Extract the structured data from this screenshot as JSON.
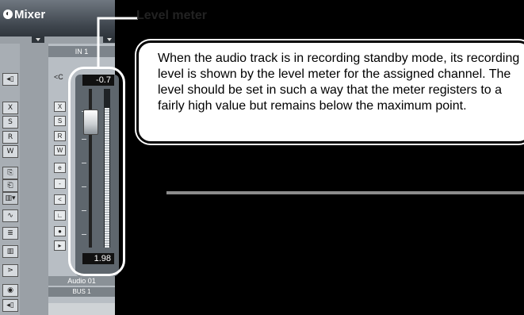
{
  "mixer": {
    "title": "Mixer",
    "input_label": "IN 1",
    "pan_text": "<C",
    "track_name": "Audio 01",
    "bus_name": "BUS 1",
    "toolbar_icons": [
      "input-monitor-icon",
      "mute-icon",
      "solo-icon",
      "record-icon",
      "write-icon",
      "copy-icon",
      "paste-icon",
      "view-menu-icon",
      "effects-icon",
      "sends-icon",
      "keyboard-icon",
      "midi-icon",
      "output-icon",
      "routing-icon"
    ]
  },
  "fader": {
    "top_value": "-0.7",
    "bottom_value": "1.98",
    "meter_level_fraction": 0.88
  },
  "callout": {
    "title": "Level meter",
    "text": "When the audio track is in recording standby mode, its recording level is shown by the level meter for the assigned channel. The level should be set in such a way that the meter registers to a fairly high value but remains below the maximum point."
  }
}
